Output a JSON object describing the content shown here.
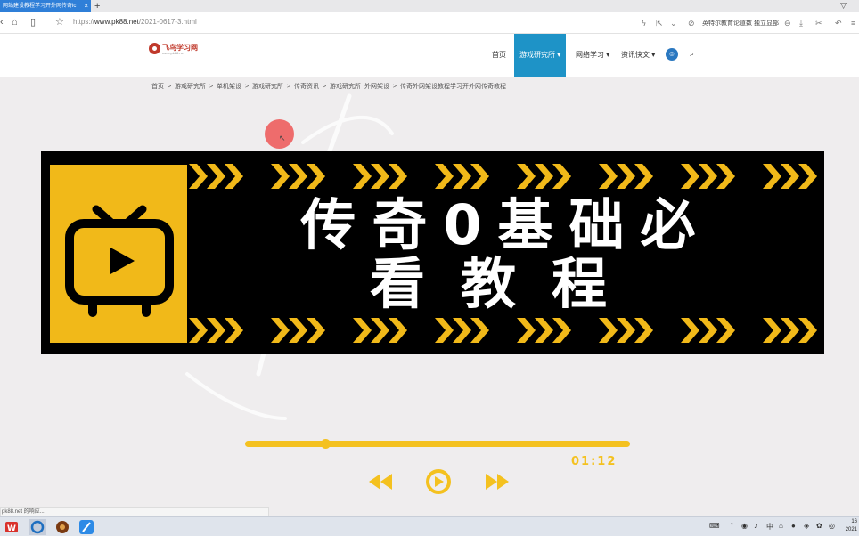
{
  "browser": {
    "tab_title": "网站建设教程学习开外网传奇ic",
    "tab_close": "×",
    "new_tab": "+",
    "url_prefix": "https://",
    "url_main": "www.pk88.net",
    "url_path": "/2021-0617-3.html",
    "bookmark_text": "英特尔教育论道数 独立显部",
    "icons": [
      "back-icon",
      "home-icon",
      "reader-icon",
      "star-icon",
      "share-icon",
      "extension-icon",
      "ad-block-icon",
      "download-icon",
      "cut-icon",
      "undo-icon",
      "menu-icon"
    ]
  },
  "site": {
    "logo_text": "飞鸟学习网",
    "logo_sub": "www.pk88.net",
    "nav": [
      {
        "label": "首页"
      },
      {
        "label": "游戏研究所 ▾"
      },
      {
        "label": "网络学习 ▾"
      },
      {
        "label": "资讯快文 ▾"
      }
    ]
  },
  "breadcrumb": [
    "首页",
    ">",
    "游戏研究所",
    ">",
    "单机架设",
    ">",
    "游戏研究所",
    ">",
    "传奇资讯",
    ">",
    "游戏研究所",
    "外网架设",
    ">",
    "传奇外网架设教程学习开外网传奇教程"
  ],
  "banner": {
    "title_line1": "传奇0基础必",
    "title_line2": "看教程",
    "accent_color": "#f1b919"
  },
  "player": {
    "progress": 0.21,
    "time": "01:12"
  },
  "status_tip": "pk88.net 的响应...",
  "taskbar": {
    "apps": [
      "wps-icon",
      "browser-icon",
      "game-icon",
      "feather-icon"
    ],
    "tray": [
      "keyboard-icon",
      "network-icon",
      "bluetooth-icon",
      "volume-icon",
      "wifi-icon",
      "qq-icon",
      "security-icon",
      "input-icon"
    ],
    "clock_time": "16",
    "clock_date": "2021"
  }
}
